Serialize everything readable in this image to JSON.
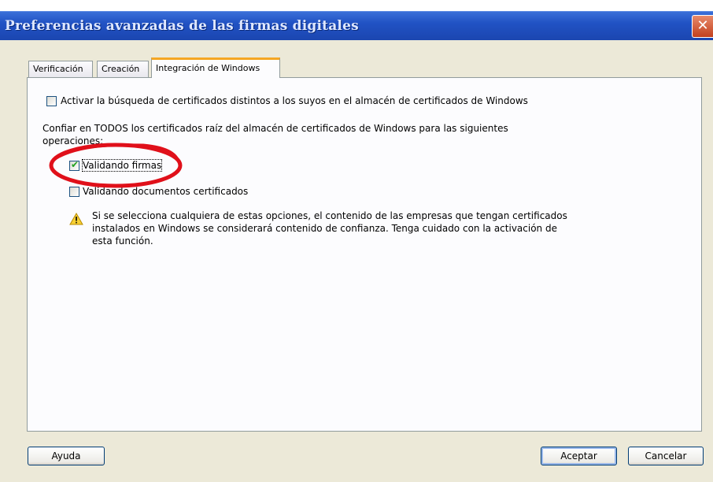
{
  "window": {
    "title": "Preferencias avanzadas de las firmas digitales",
    "close_glyph": "✕"
  },
  "tabs": [
    {
      "label": "Verificación"
    },
    {
      "label": "Creación"
    },
    {
      "label": "Integración de Windows",
      "active": true
    }
  ],
  "options": {
    "search_certs": {
      "label": "Activar la búsqueda de certificados distintos a los suyos en el almacén de certificados de Windows",
      "checked": false
    },
    "trust_text": "Confiar en TODOS los certificados raíz del almacén de certificados de Windows para las siguientes operaciones:",
    "validate_signatures": {
      "label": "Validando firmas",
      "checked": true
    },
    "validate_documents": {
      "label": "Validando documentos certificados",
      "checked": false
    },
    "warning": "Si se selecciona cualquiera de estas opciones, el contenido de las empresas que tengan certificados instalados en Windows se considerará contenido de confianza. Tenga cuidado con la activación de esta función."
  },
  "buttons": {
    "help": "Ayuda",
    "accept": "Aceptar",
    "cancel": "Cancelar"
  },
  "colors": {
    "titlebar": "#2152c4",
    "annotation": "#e0101a",
    "tab_highlight": "#f5a623"
  }
}
